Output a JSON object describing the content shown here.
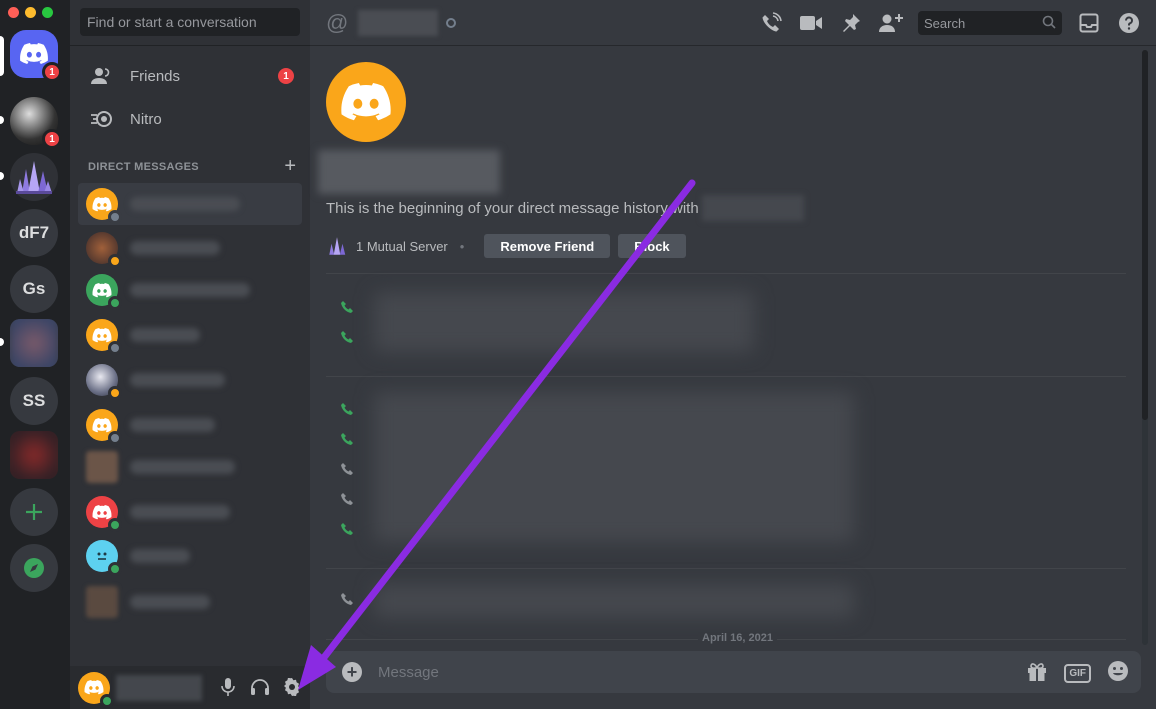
{
  "sidebar": {
    "search_placeholder": "Find or start a conversation",
    "friends_label": "Friends",
    "friends_badge": "1",
    "nitro_label": "Nitro",
    "dm_header": "Direct Messages",
    "add_dm": "+"
  },
  "rail": {
    "home_badge": "1",
    "server1_badge": "1",
    "server_df7": "dF7",
    "server_gs": "Gs",
    "server_ss": "SS"
  },
  "topbar": {
    "at_symbol": "@",
    "search_placeholder": "Search"
  },
  "intro": {
    "text": "This is the beginning of your direct message history with",
    "mutual_servers": "1 Mutual Server",
    "remove_friend": "Remove Friend",
    "block": "Block"
  },
  "date_divider": "April 16, 2021",
  "composer": {
    "placeholder": "Message",
    "gif_label": "GIF"
  },
  "colors": {
    "blurple": "#5865f2",
    "orange": "#faa61a",
    "green": "#3ba55d",
    "red": "#ed4245",
    "arrow": "#8a2be2"
  }
}
